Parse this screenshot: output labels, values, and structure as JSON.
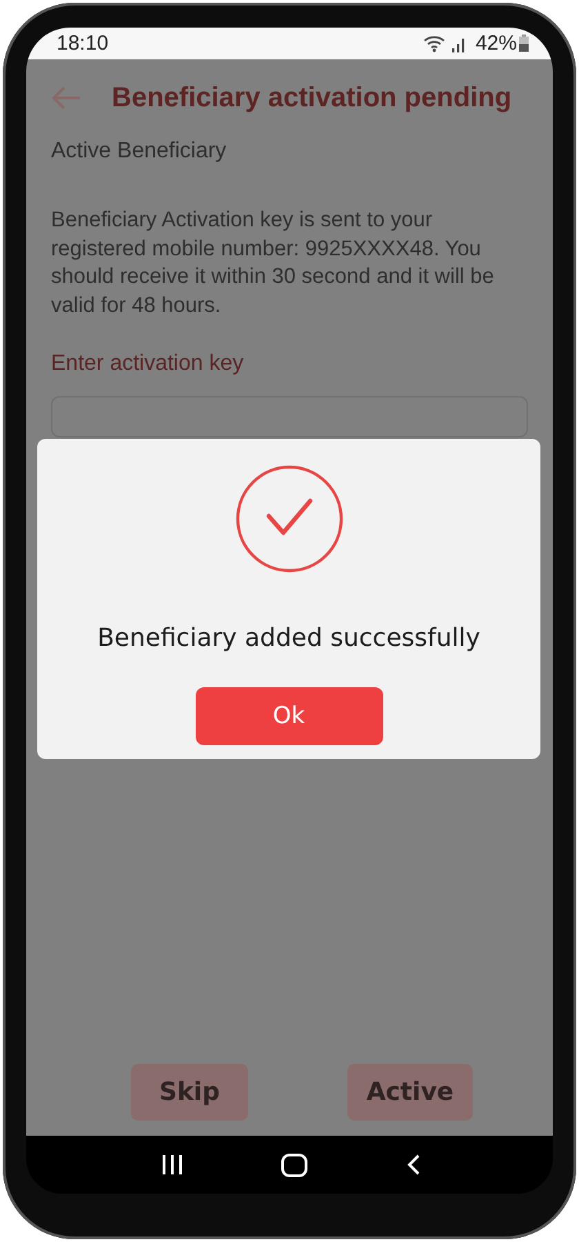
{
  "status_bar": {
    "time": "18:10",
    "battery": "42%"
  },
  "app_bar": {
    "title": "Beneficiary activation pending"
  },
  "section_title": "Active Beneficiary",
  "message": "Beneficiary Activation key is sent to your registered mobile number: 9925XXXX48. You should receive it within 30 second and it will be valid for 48 hours.",
  "activation_key": {
    "label": "Enter activation key"
  },
  "buttons": [
    {
      "label": "Skip"
    },
    {
      "label": "Active"
    }
  ],
  "dialog": {
    "message": "Beneficiary added successfully",
    "button": "Ok"
  }
}
